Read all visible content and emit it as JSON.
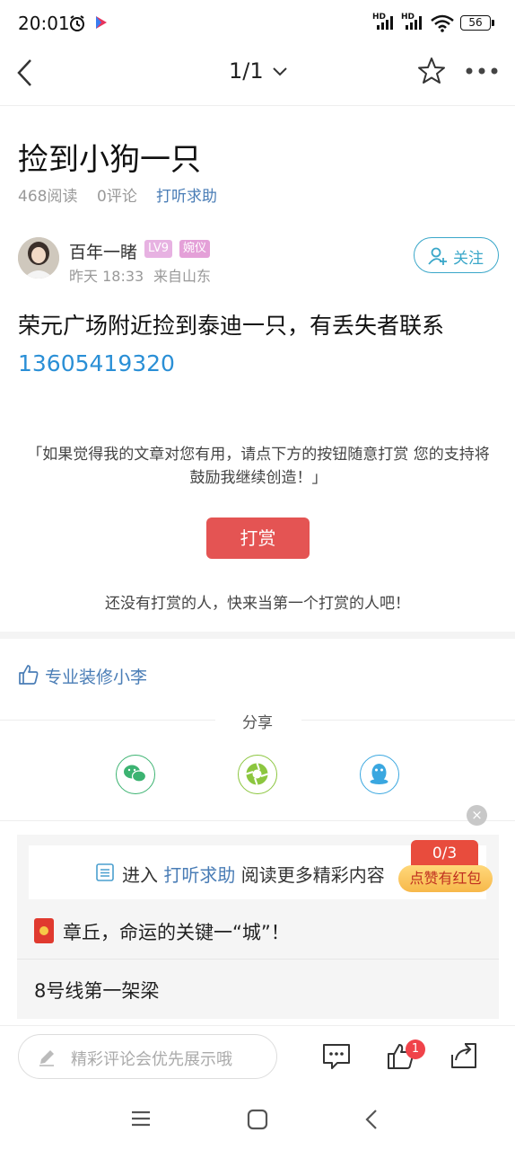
{
  "status_bar": {
    "time": "20:01",
    "signal1_label": "HD",
    "signal2_label": "HD",
    "battery": "56"
  },
  "top_bar": {
    "page_indicator": "1/1"
  },
  "post": {
    "title": "捡到小狗一只",
    "reads": "468阅读",
    "comments": "0评论",
    "category": "打听求助",
    "author": {
      "name": "百年一睹",
      "level": "LV9",
      "badge": "婉仪",
      "time": "昨天 18:33",
      "location": "来自山东"
    },
    "follow_label": "关注",
    "body": "荣元广场附近捡到泰迪一只，有丢失者联系",
    "phone": "13605419320"
  },
  "reward": {
    "text": "「如果觉得我的文章对您有用，请点下方的按钮随意打赏 您的支持将鼓励我继续创造！」",
    "button_label": "打赏",
    "empty_text": "还没有打赏的人，快来当第一个打赏的人吧！"
  },
  "likes": {
    "liker": "专业装修小李"
  },
  "share": {
    "label": "分享"
  },
  "promo": {
    "close": "×",
    "enter_prefix": "进入 ",
    "enter_category": "打听求助",
    "enter_suffix": " 阅读更多精彩内容",
    "counter": "0/3",
    "redpack": "点赞有红包"
  },
  "related": [
    {
      "title": "章丘，命运的关键一“城”！"
    },
    {
      "title": "8号线第一架梁"
    }
  ],
  "bottom_bar": {
    "comment_placeholder": "精彩评论会优先展示哦",
    "like_count": "1"
  },
  "colors": {
    "accent_blue": "#4a7db6",
    "phone_blue": "#2a8fd6",
    "reward_red": "#e45453",
    "follow_teal": "#3aa7c9"
  }
}
